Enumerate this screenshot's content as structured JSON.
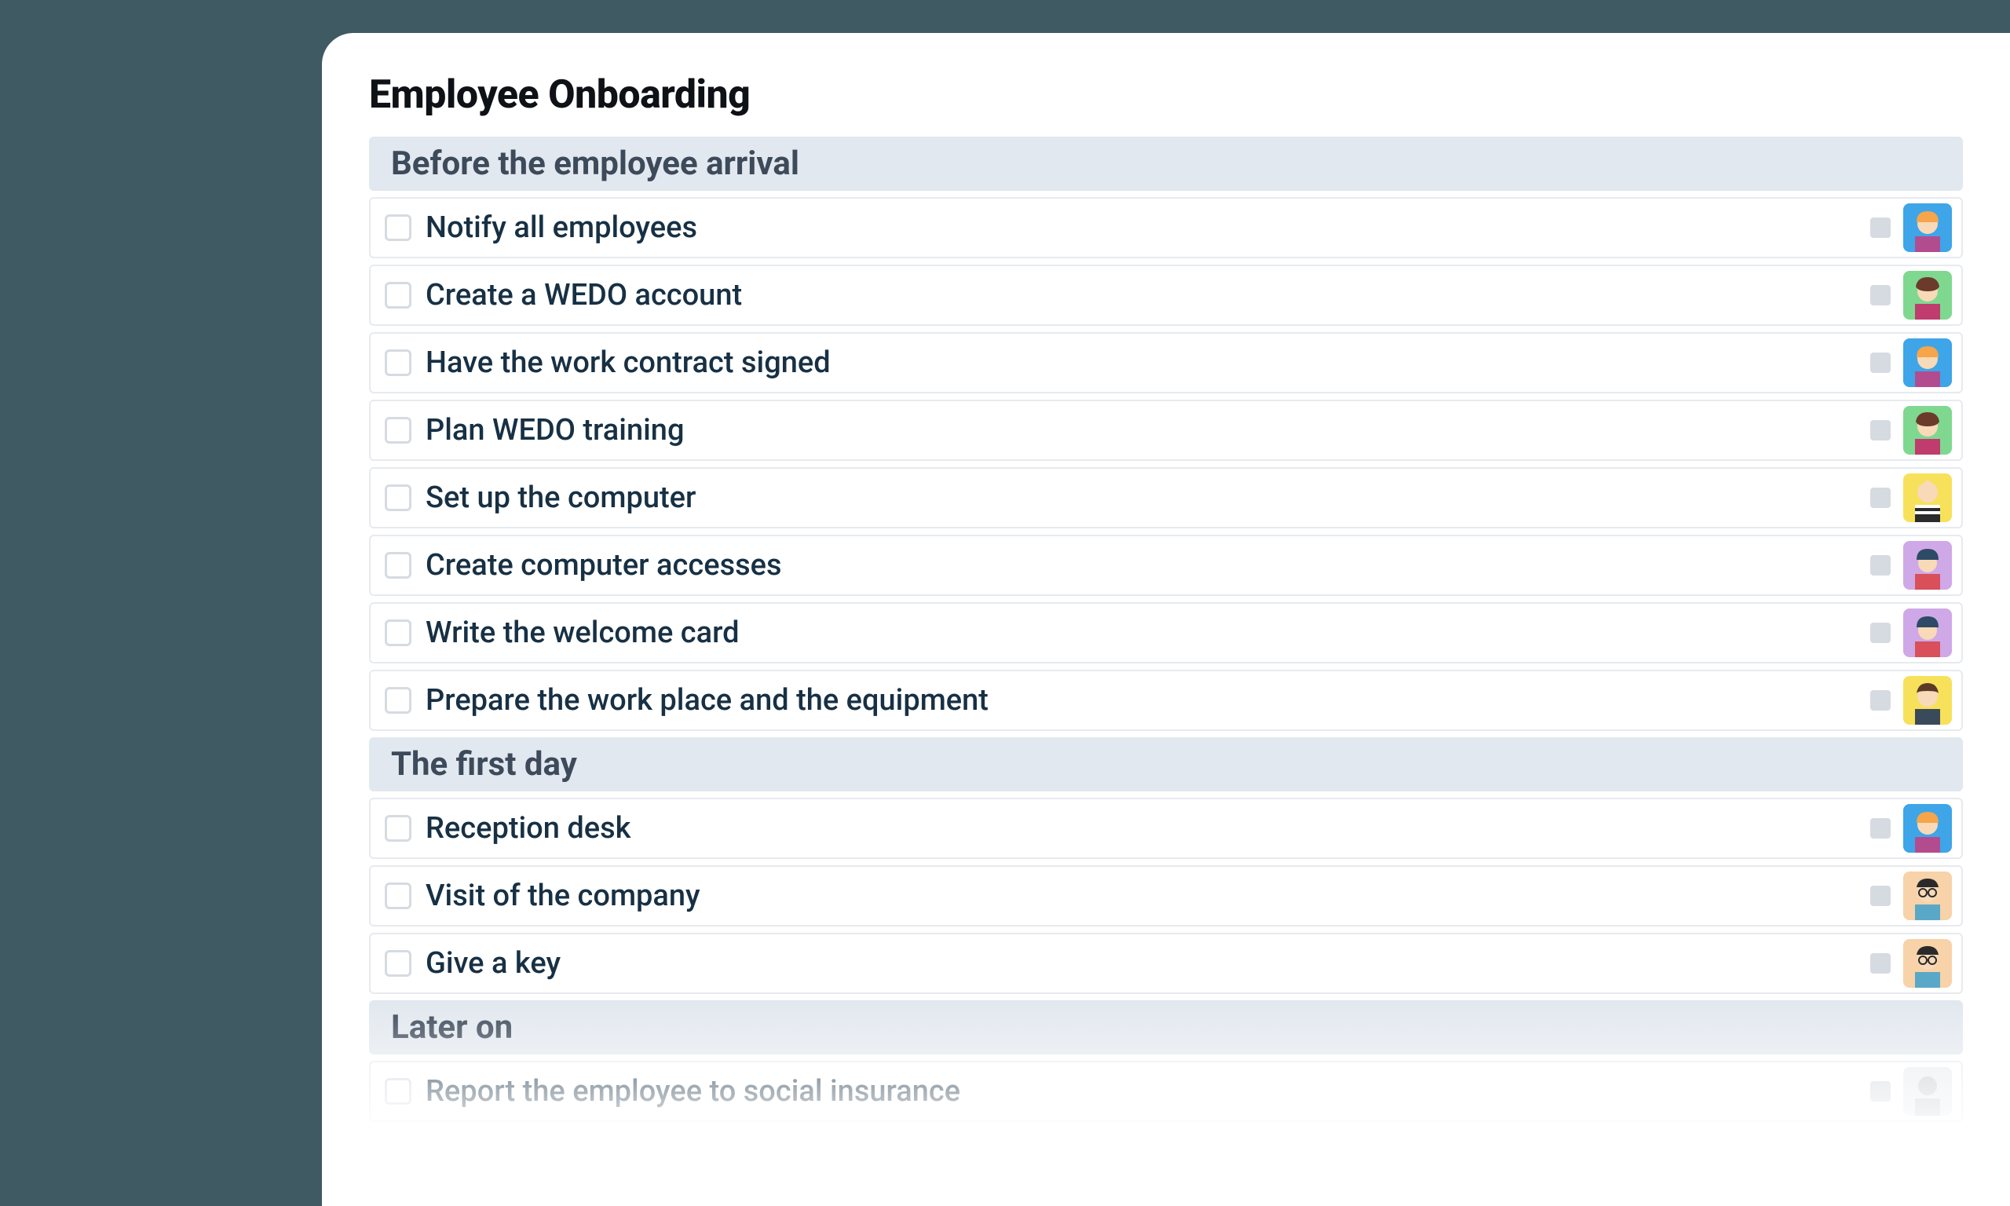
{
  "title": "Employee Onboarding",
  "sections": [
    {
      "header": "Before the employee arrival",
      "tasks": [
        {
          "label": "Notify all employees",
          "avatar": "blue-orange"
        },
        {
          "label": "Create a WEDO account",
          "avatar": "green-brown"
        },
        {
          "label": "Have the work contract signed",
          "avatar": "blue-orange"
        },
        {
          "label": "Plan WEDO training",
          "avatar": "green-brown"
        },
        {
          "label": "Set up the computer",
          "avatar": "yellow-bald"
        },
        {
          "label": "Create computer accesses",
          "avatar": "purple-beanie"
        },
        {
          "label": "Write the welcome card",
          "avatar": "purple-beanie"
        },
        {
          "label": "Prepare the work place and the equipment",
          "avatar": "yellow-brownf"
        }
      ]
    },
    {
      "header": "The first day",
      "tasks": [
        {
          "label": "Reception desk",
          "avatar": "blue-orange"
        },
        {
          "label": "Visit of the company",
          "avatar": "peach-glasses"
        },
        {
          "label": "Give a key",
          "avatar": "peach-glasses"
        }
      ]
    },
    {
      "header": "Later on",
      "tasks": [
        {
          "label": "Report the employee to social insurance",
          "avatar": "gray-blank"
        }
      ]
    }
  ]
}
